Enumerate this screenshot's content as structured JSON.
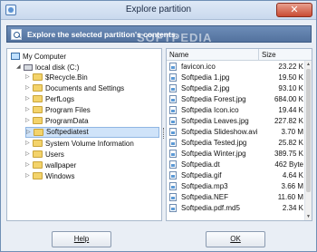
{
  "window": {
    "title": "Explore partition",
    "close_glyph": "✕"
  },
  "banner": {
    "text": "Explore the selected partition's contents.",
    "watermark": "SOFTPEDIA"
  },
  "tree": {
    "root": "My Computer",
    "drive": "local disk (C:)",
    "folders": [
      "$Recycle.Bin",
      "Documents and Settings",
      "PerfLogs",
      "Program Files",
      "ProgramData",
      "Softpediatest",
      "System Volume Information",
      "Users",
      "wallpaper",
      "Windows"
    ],
    "selected_folder": "Softpediatest"
  },
  "file_list": {
    "columns": {
      "name": "Name",
      "size": "Size"
    },
    "rows": [
      {
        "name": "favicon.ico",
        "size": "23.22 K"
      },
      {
        "name": "Softpedia 1.jpg",
        "size": "19.50 K"
      },
      {
        "name": "Softpedia 2.jpg",
        "size": "93.10 K"
      },
      {
        "name": "Softpedia Forest.jpg",
        "size": "684.00 K"
      },
      {
        "name": "Softpedia Icon.ico",
        "size": "19.44 K"
      },
      {
        "name": "Softpedia Leaves.jpg",
        "size": "227.82 K"
      },
      {
        "name": "Softpedia Slideshow.avi",
        "size": "3.70 M"
      },
      {
        "name": "Softpedia Tested.jpg",
        "size": "25.82 K"
      },
      {
        "name": "Softpedia Winter.jpg",
        "size": "389.75 K"
      },
      {
        "name": "Softpedia.dt",
        "size": "462 Byte"
      },
      {
        "name": "Softpedia.gif",
        "size": "4.64 K"
      },
      {
        "name": "Softpedia.mp3",
        "size": "3.66 M"
      },
      {
        "name": "Softpedia.NEF",
        "size": "11.60 M"
      },
      {
        "name": "Softpedia.pdf.md5",
        "size": "2.34 K"
      }
    ]
  },
  "buttons": {
    "help": "Help",
    "ok": "OK"
  },
  "colors": {
    "banner": "#5f7fab",
    "selection": "#cfe3f9",
    "close": "#c94b33"
  }
}
